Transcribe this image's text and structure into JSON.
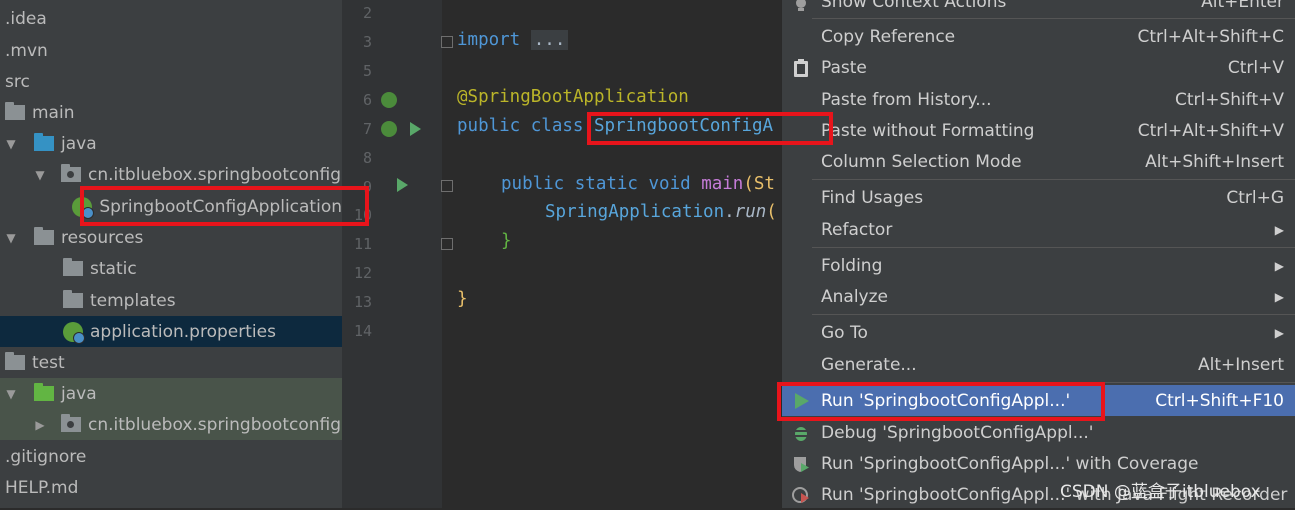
{
  "project_tree": [
    {
      "label": ".idea",
      "type": "file"
    },
    {
      "label": ".mvn",
      "type": "file"
    },
    {
      "label": "src",
      "type": "file"
    },
    {
      "label": "main",
      "type": "folder"
    },
    {
      "label": "java",
      "type": "folder"
    },
    {
      "label": "cn.itbluebox.springbootconfig",
      "type": "package"
    },
    {
      "label": "SpringbootConfigApplication",
      "type": "class"
    },
    {
      "label": "resources",
      "type": "folder"
    },
    {
      "label": "static",
      "type": "folder"
    },
    {
      "label": "templates",
      "type": "folder"
    },
    {
      "label": "application.properties",
      "type": "properties"
    },
    {
      "label": "test",
      "type": "folder"
    },
    {
      "label": "java",
      "type": "folder"
    },
    {
      "label": "cn.itbluebox.springbootconfig",
      "type": "package"
    },
    {
      "label": ".gitignore",
      "type": "file"
    },
    {
      "label": "HELP.md",
      "type": "file"
    }
  ],
  "editor": {
    "line_numbers": [
      "2",
      "3",
      "5",
      "6",
      "7",
      "8",
      "9",
      "10",
      "11",
      "12",
      "13",
      "14"
    ],
    "code": {
      "import_kw": "import",
      "import_fold": "...",
      "annotation": "@SpringBootApplication",
      "class_decl_kw": "public class",
      "class_name": "SpringbootConfigA",
      "main_kw": "public static void",
      "main_name": "main",
      "main_paren": "(St",
      "run_class": "SpringApplication",
      "run_dot": ".",
      "run_method": "run",
      "run_paren": "(",
      "close_inner": "}",
      "close_outer": "}"
    }
  },
  "context_menu": {
    "items": [
      {
        "label": "Show Context Actions",
        "shortcut": "Alt+Enter"
      },
      {
        "label": "Copy Reference",
        "shortcut": "Ctrl+Alt+Shift+C"
      },
      {
        "label": "Paste",
        "shortcut": "Ctrl+V"
      },
      {
        "label": "Paste from History...",
        "shortcut": "Ctrl+Shift+V"
      },
      {
        "label": "Paste without Formatting",
        "shortcut": "Ctrl+Alt+Shift+V"
      },
      {
        "label": "Column Selection Mode",
        "shortcut": "Alt+Shift+Insert"
      },
      {
        "label": "Find Usages",
        "shortcut": "Ctrl+G"
      },
      {
        "label": "Refactor",
        "shortcut": ""
      },
      {
        "label": "Folding",
        "shortcut": ""
      },
      {
        "label": "Analyze",
        "shortcut": ""
      },
      {
        "label": "Go To",
        "shortcut": ""
      },
      {
        "label": "Generate...",
        "shortcut": "Alt+Insert"
      },
      {
        "label": "Run 'SpringbootConfigAppl...'",
        "shortcut": "Ctrl+Shift+F10"
      },
      {
        "label": "Debug 'SpringbootConfigAppl...'",
        "shortcut": ""
      },
      {
        "label": "Run 'SpringbootConfigAppl...' with Coverage",
        "shortcut": ""
      },
      {
        "label": "Run 'SpringbootConfigAppl...' with Java Flight Recorder",
        "shortcut": ""
      }
    ]
  },
  "watermark": "CSDN @蓝盒子itbluebox",
  "colors": {
    "highlight": "#e8141b",
    "menu_selected": "#4b6eaf",
    "run_green": "#59a869"
  }
}
